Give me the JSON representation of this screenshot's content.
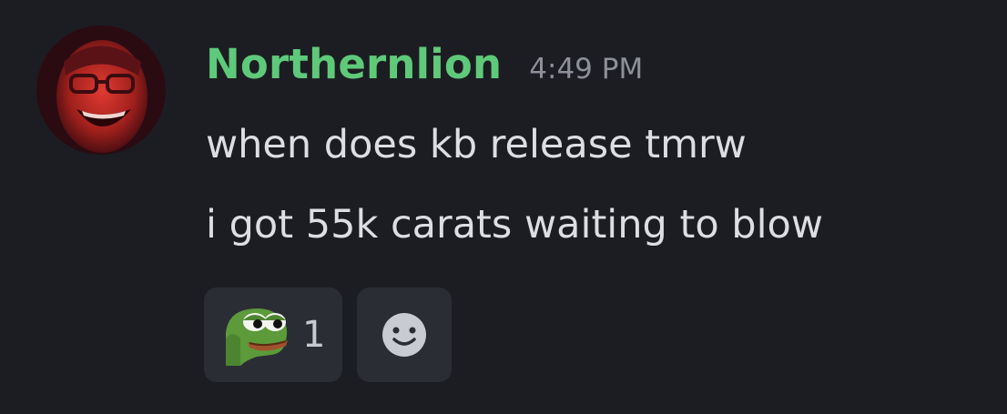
{
  "message": {
    "author": "Northernlion",
    "timestamp": "4:49 PM",
    "lines": [
      "when does kb release tmrw",
      "i got 55k carats waiting to blow"
    ],
    "avatar_icon": "avatar-laughing-man",
    "reactions": [
      {
        "emoji": "pepe-frog-emoji",
        "count": "1"
      }
    ],
    "add_reaction_icon": "smiley-icon"
  },
  "colors": {
    "background": "#1c1d22",
    "username": "#5fc97a",
    "text": "#dcdee3",
    "timestamp": "#8e9099",
    "reaction_bg": "#2b2d34"
  }
}
